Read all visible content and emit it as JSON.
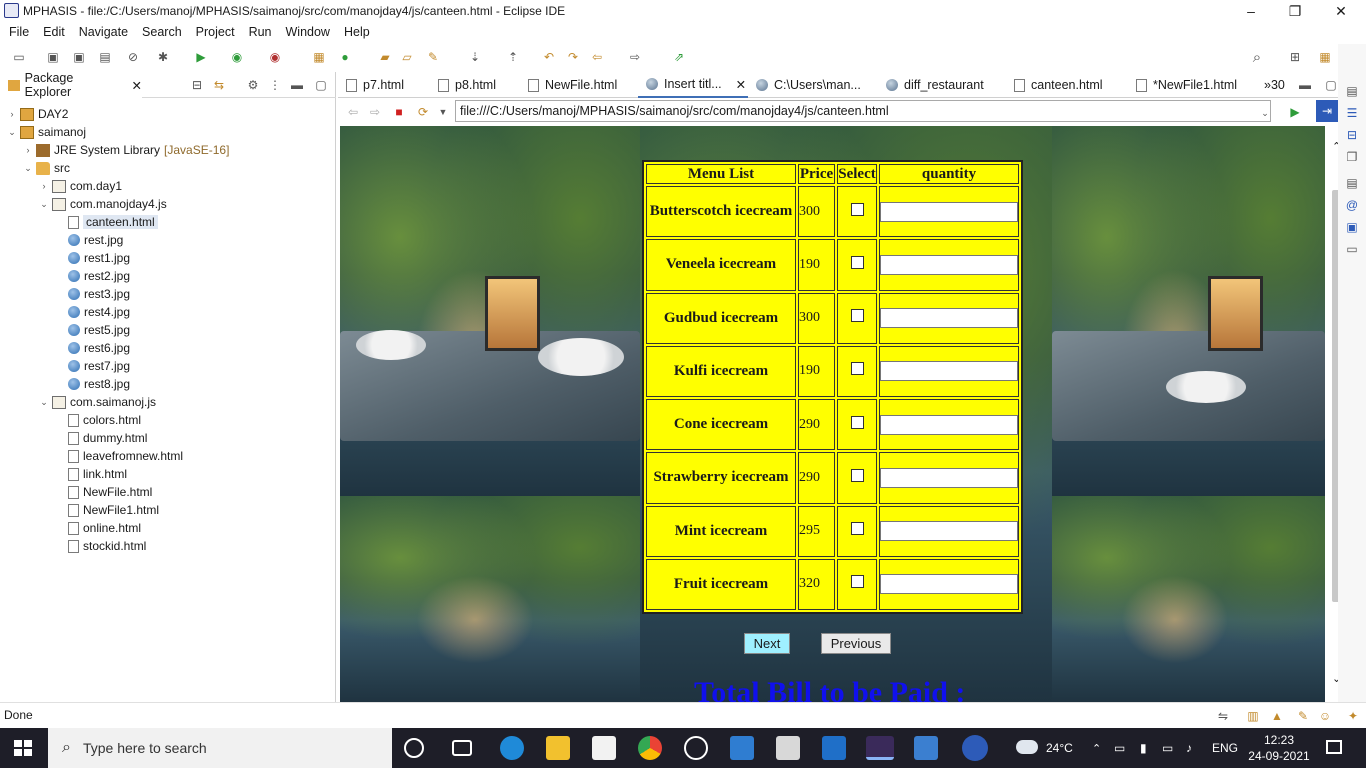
{
  "window": {
    "title": "MPHASIS - file:/C:/Users/manoj/MPHASIS/saimanoj/src/com/manojday4/js/canteen.html - Eclipse IDE",
    "minimize_glyph": "–",
    "restore_glyph": "❐",
    "close_glyph": "✕"
  },
  "menubar": [
    "File",
    "Edit",
    "Navigate",
    "Search",
    "Project",
    "Run",
    "Window",
    "Help"
  ],
  "package_explorer": {
    "tab_label": "Package Explorer",
    "tree": [
      {
        "label": "DAY2",
        "twisty": "›",
        "icon": "project"
      },
      {
        "label": "saimanoj",
        "twisty": "⌄",
        "icon": "project"
      },
      {
        "label": "JRE System Library",
        "tag": "[JavaSE-16]",
        "twisty": "›",
        "icon": "library"
      },
      {
        "label": "src",
        "twisty": "⌄",
        "icon": "folder"
      },
      {
        "label": "com.day1",
        "twisty": "›",
        "icon": "package"
      },
      {
        "label": "com.manojday4.js",
        "twisty": "⌄",
        "icon": "package"
      },
      {
        "label": "canteen.html",
        "icon": "file",
        "selected": true
      },
      {
        "label": "rest.jpg",
        "icon": "image"
      },
      {
        "label": "rest1.jpg",
        "icon": "image"
      },
      {
        "label": "rest2.jpg",
        "icon": "image"
      },
      {
        "label": "rest3.jpg",
        "icon": "image"
      },
      {
        "label": "rest4.jpg",
        "icon": "image"
      },
      {
        "label": "rest5.jpg",
        "icon": "image"
      },
      {
        "label": "rest6.jpg",
        "icon": "image"
      },
      {
        "label": "rest7.jpg",
        "icon": "image"
      },
      {
        "label": "rest8.jpg",
        "icon": "image"
      },
      {
        "label": "com.saimanoj.js",
        "twisty": "⌄",
        "icon": "package"
      },
      {
        "label": "colors.html",
        "icon": "file"
      },
      {
        "label": "dummy.html",
        "icon": "file"
      },
      {
        "label": "leavefromnew.html",
        "icon": "file"
      },
      {
        "label": "link.html",
        "icon": "file"
      },
      {
        "label": "NewFile.html",
        "icon": "file"
      },
      {
        "label": "NewFile1.html",
        "icon": "file"
      },
      {
        "label": "online.html",
        "icon": "file"
      },
      {
        "label": "stockid.html",
        "icon": "file"
      }
    ]
  },
  "editor_tabs": [
    {
      "label": "p7.html",
      "icon": "file"
    },
    {
      "label": "p8.html",
      "icon": "file"
    },
    {
      "label": "NewFile.html",
      "icon": "file"
    },
    {
      "label": "Insert titl...",
      "icon": "globe",
      "active": true,
      "close": "✕"
    },
    {
      "label": "C:\\Users\\man...",
      "icon": "globe"
    },
    {
      "label": "diff_restaurant",
      "icon": "globe"
    },
    {
      "label": "canteen.html",
      "icon": "file"
    },
    {
      "label": "*NewFile1.html",
      "icon": "file"
    },
    {
      "label": "»30",
      "icon": "none"
    }
  ],
  "browser": {
    "url": "file:///C:/Users/manoj/MPHASIS/saimanoj/src/com/manojday4/js/canteen.html"
  },
  "page": {
    "headers": {
      "menu": "Menu List",
      "price": "Price",
      "select": "Select",
      "quantity": "quantity"
    },
    "items": [
      {
        "name": "Butterscotch icecream",
        "price": "300"
      },
      {
        "name": "Veneela icecream",
        "price": "190"
      },
      {
        "name": "Gudbud icecream",
        "price": "300"
      },
      {
        "name": "Kulfi icecream",
        "price": "190"
      },
      {
        "name": "Cone icecream",
        "price": "290"
      },
      {
        "name": "Strawberry icecream",
        "price": "290"
      },
      {
        "name": "Mint icecream",
        "price": "295"
      },
      {
        "name": "Fruit icecream",
        "price": "320"
      }
    ],
    "next_label": "Next",
    "previous_label": "Previous",
    "total_label": "Total Bill to be Paid :"
  },
  "status": {
    "text": "Done"
  },
  "taskbar": {
    "search_placeholder": "Type here to search",
    "weather": "24°C",
    "language": "ENG",
    "time": "12:23",
    "date": "24-09-2021"
  },
  "colors": {
    "menu_bg": "#ffff00",
    "next_bg": "#9ff0ff",
    "total_text": "#1010ee",
    "accent": "#3f6fb6"
  }
}
